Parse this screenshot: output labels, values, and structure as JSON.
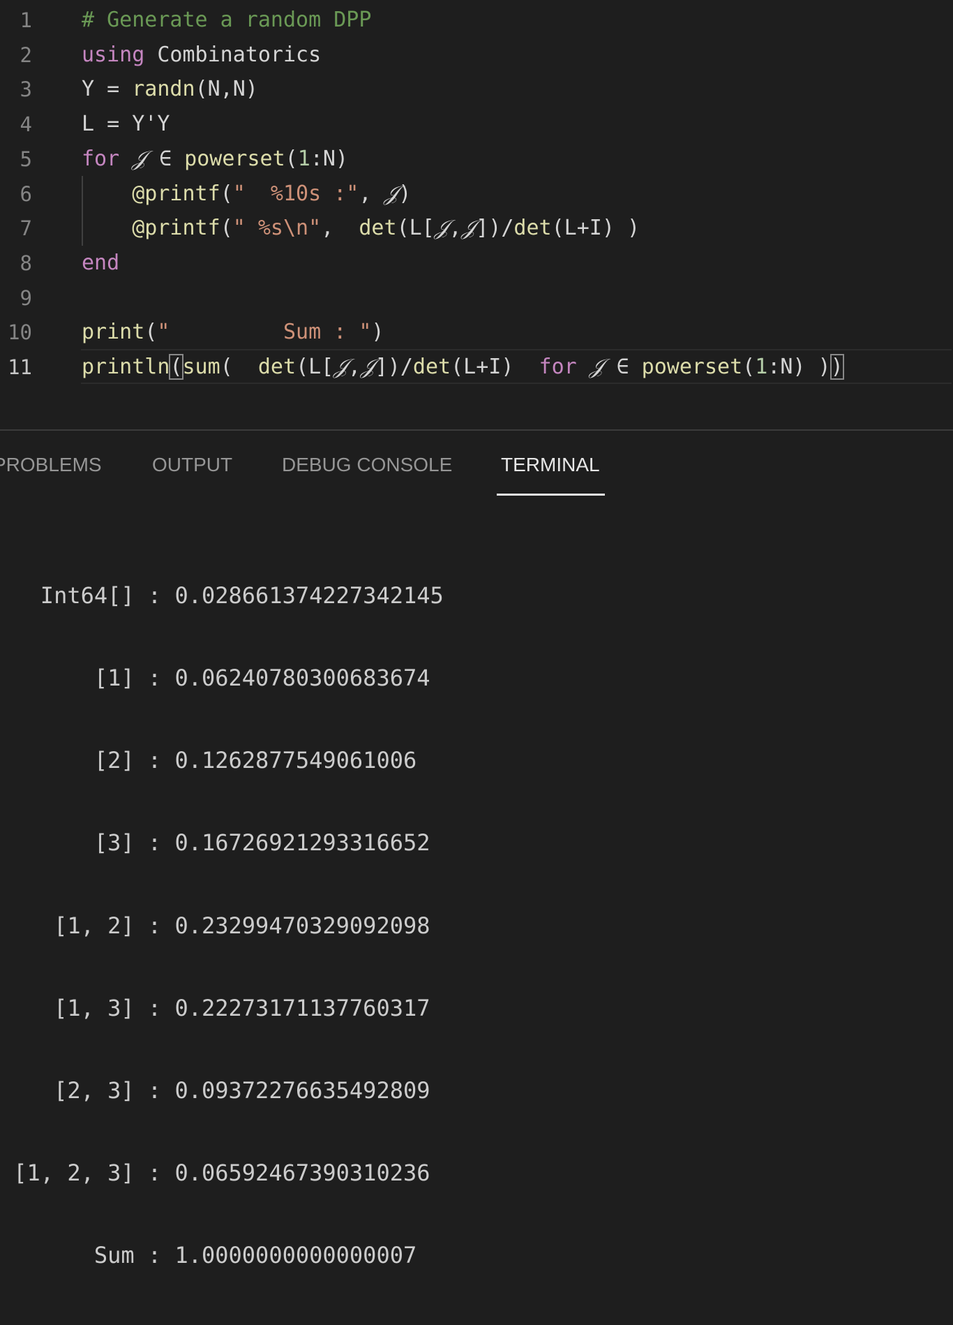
{
  "editor": {
    "lines": [
      {
        "num": "1",
        "tokens": [
          {
            "t": "# Generate a random DPP",
            "c": "comment"
          }
        ]
      },
      {
        "num": "2",
        "tokens": [
          {
            "t": "using",
            "c": "keyword"
          },
          {
            "t": " Combinatorics",
            "c": "plain"
          }
        ]
      },
      {
        "num": "3",
        "tokens": [
          {
            "t": "Y = ",
            "c": "plain"
          },
          {
            "t": "randn",
            "c": "fn"
          },
          {
            "t": "(N,N)",
            "c": "plain"
          }
        ]
      },
      {
        "num": "4",
        "tokens": [
          {
            "t": "L = Y'Y",
            "c": "plain"
          }
        ]
      },
      {
        "num": "5",
        "tokens": [
          {
            "t": "for",
            "c": "keyword"
          },
          {
            "t": " ",
            "c": "plain"
          },
          {
            "t": "𝒥",
            "c": "ital"
          },
          {
            "t": " ∈ ",
            "c": "plain"
          },
          {
            "t": "powerset",
            "c": "fn"
          },
          {
            "t": "(",
            "c": "plain"
          },
          {
            "t": "1",
            "c": "num"
          },
          {
            "t": ":N)",
            "c": "plain"
          }
        ]
      },
      {
        "num": "6",
        "tokens": [
          {
            "t": "    ",
            "c": "plain"
          },
          {
            "t": "@printf",
            "c": "fn"
          },
          {
            "t": "(",
            "c": "plain"
          },
          {
            "t": "\"  %10s :\"",
            "c": "str"
          },
          {
            "t": ", ",
            "c": "plain"
          },
          {
            "t": "𝒥",
            "c": "ital"
          },
          {
            "t": ")",
            "c": "plain"
          }
        ]
      },
      {
        "num": "7",
        "tokens": [
          {
            "t": "    ",
            "c": "plain"
          },
          {
            "t": "@printf",
            "c": "fn"
          },
          {
            "t": "(",
            "c": "plain"
          },
          {
            "t": "\" %s\\n\"",
            "c": "str"
          },
          {
            "t": ",  ",
            "c": "plain"
          },
          {
            "t": "det",
            "c": "fn"
          },
          {
            "t": "(L[",
            "c": "plain"
          },
          {
            "t": "𝒥",
            "c": "ital"
          },
          {
            "t": ",",
            "c": "plain"
          },
          {
            "t": "𝒥",
            "c": "ital"
          },
          {
            "t": "])/",
            "c": "plain"
          },
          {
            "t": "det",
            "c": "fn"
          },
          {
            "t": "(L+I) )",
            "c": "plain"
          }
        ]
      },
      {
        "num": "8",
        "tokens": [
          {
            "t": "end",
            "c": "keyword"
          }
        ]
      },
      {
        "num": "9",
        "tokens": []
      },
      {
        "num": "10",
        "tokens": [
          {
            "t": "print",
            "c": "fn"
          },
          {
            "t": "(",
            "c": "plain"
          },
          {
            "t": "\"         Sum : \"",
            "c": "str"
          },
          {
            "t": ")",
            "c": "plain"
          }
        ]
      },
      {
        "num": "11",
        "tokens": [
          {
            "t": "println",
            "c": "fn"
          },
          {
            "t": "(",
            "c": "plain",
            "bracket": true
          },
          {
            "t": "sum",
            "c": "fn"
          },
          {
            "t": "(  ",
            "c": "plain"
          },
          {
            "t": "det",
            "c": "fn"
          },
          {
            "t": "(L[",
            "c": "plain"
          },
          {
            "t": "𝒥",
            "c": "ital"
          },
          {
            "t": ",",
            "c": "plain"
          },
          {
            "t": "𝒥",
            "c": "ital"
          },
          {
            "t": "])/",
            "c": "plain"
          },
          {
            "t": "det",
            "c": "fn"
          },
          {
            "t": "(L+I)  ",
            "c": "plain"
          },
          {
            "t": "for",
            "c": "keyword"
          },
          {
            "t": " ",
            "c": "plain"
          },
          {
            "t": "𝒥",
            "c": "ital"
          },
          {
            "t": " ∈ ",
            "c": "plain"
          },
          {
            "t": "powerset",
            "c": "fn"
          },
          {
            "t": "(",
            "c": "plain"
          },
          {
            "t": "1",
            "c": "num"
          },
          {
            "t": ":N) )",
            "c": "plain"
          },
          {
            "t": ")",
            "c": "plain",
            "bracket": true
          }
        ]
      }
    ],
    "active_line": "11"
  },
  "panel": {
    "tabs": [
      {
        "label": "PROBLEMS",
        "active": false
      },
      {
        "label": "OUTPUT",
        "active": false
      },
      {
        "label": "DEBUG CONSOLE",
        "active": false
      },
      {
        "label": "TERMINAL",
        "active": true
      }
    ]
  },
  "terminal": {
    "lines": [
      "   Int64[] : 0.028661374227342145",
      "       [1] : 0.06240780300683674",
      "       [2] : 0.1262877549061006",
      "       [3] : 0.16726921293316652",
      "    [1, 2] : 0.23299470329092098",
      "    [1, 3] : 0.22273171137760317",
      "    [2, 3] : 0.09372276635492809",
      " [1, 2, 3] : 0.06592467390310236",
      "       Sum : 1.0000000000000007"
    ]
  },
  "colors": {
    "background": "#1e1e1e",
    "comment": "#6a9955",
    "keyword": "#c586c0",
    "function": "#dcdcaa",
    "string": "#ce9178",
    "number": "#b5cea8",
    "text": "#d4d4d4"
  }
}
